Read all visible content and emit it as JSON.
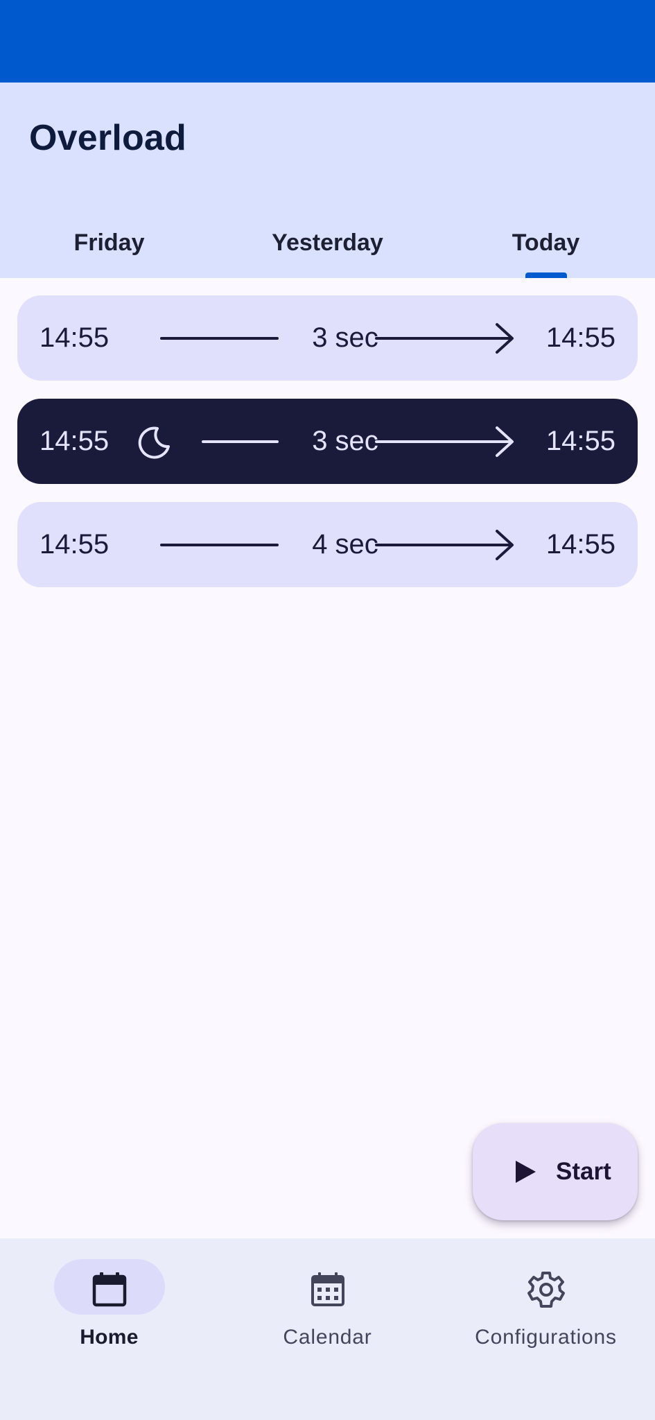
{
  "app": {
    "title": "Overload"
  },
  "tabs": [
    {
      "label": "Friday",
      "selected": false
    },
    {
      "label": "Yesterday",
      "selected": false
    },
    {
      "label": "Today",
      "selected": true
    }
  ],
  "sessions": [
    {
      "start": "14:55",
      "duration": "3 sec",
      "end": "14:55",
      "night": false
    },
    {
      "start": "14:55",
      "duration": "3 sec",
      "end": "14:55",
      "night": true,
      "icon": "moon-icon"
    },
    {
      "start": "14:55",
      "duration": "4 sec",
      "end": "14:55",
      "night": false
    }
  ],
  "fab": {
    "label": "Start",
    "icon": "play-icon"
  },
  "bottom_nav": [
    {
      "label": "Home",
      "icon": "calendar-today-icon",
      "active": true
    },
    {
      "label": "Calendar",
      "icon": "calendar-month-icon",
      "active": false
    },
    {
      "label": "Configurations",
      "icon": "gear-icon",
      "active": false
    }
  ],
  "colors": {
    "status_bar": "#005acd",
    "header": "#dae1ff",
    "tab_indicator": "#005acd",
    "session_light": "#e0e0fc",
    "session_dark": "#1a1a3a",
    "fab": "#e7def9",
    "bottom_nav": "#eaecfa"
  }
}
